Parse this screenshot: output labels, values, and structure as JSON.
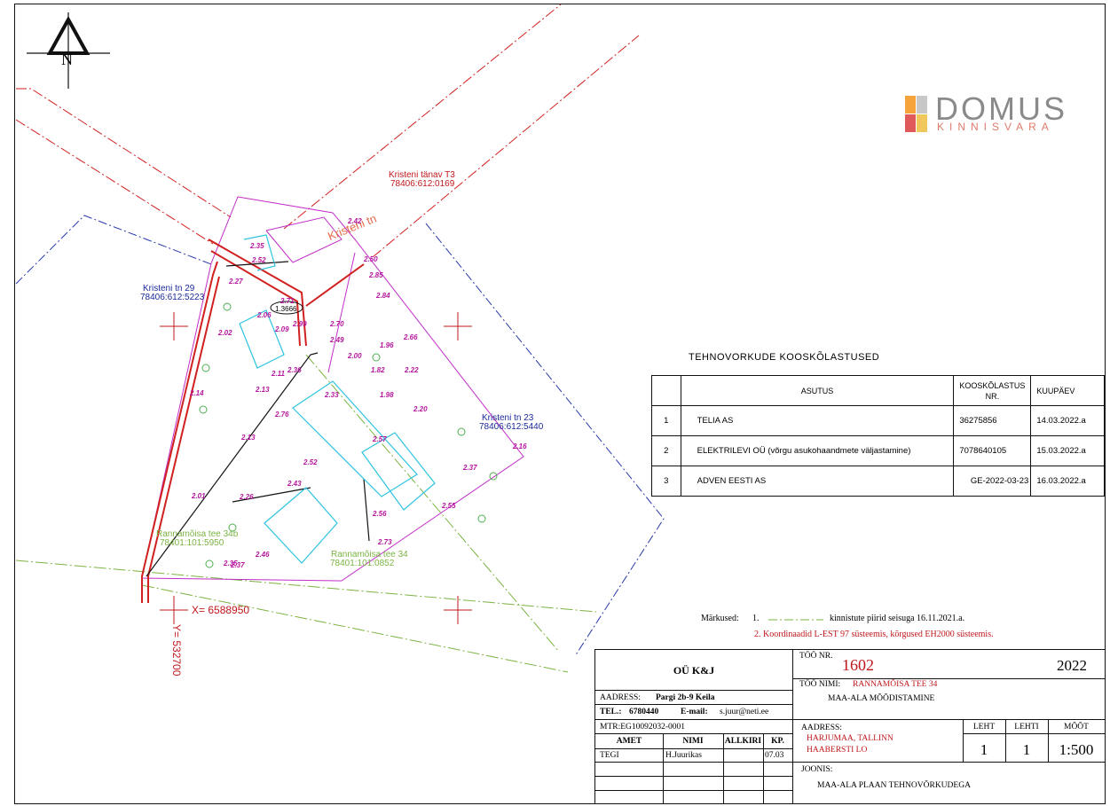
{
  "north_label": "N",
  "logo": {
    "word": "DOMUS",
    "sub": "KINNISVARA",
    "colors": [
      "#f4a43a",
      "#e05a5a",
      "#c8c8c8",
      "#f0c75a"
    ]
  },
  "plan_labels": {
    "street": "Kristeni tänav T3",
    "street_id": "78406:612:0169",
    "street_name_map": "Kristeni tn",
    "parcel29": "Kristeni tn 29",
    "parcel29_id": "78406:612:5223",
    "parcel23": "Kristeni tn 23",
    "parcel23_id": "78406:612:5440",
    "parcel34b": "Rannamõisa tee 34b",
    "parcel34b_id": "78401:101:5950",
    "parcel34": "Rannamõisa tee 34",
    "parcel34_id": "78401:101:0852",
    "area_mark": "1.3666",
    "coord_x": "X= 6588950",
    "coord_y": "Y= 532700",
    "elevations": [
      "2.35",
      "2.52",
      "2.27",
      "2.06",
      "2.02",
      "2.14",
      "2.13",
      "2.01",
      "2.26",
      "2.46",
      "2.35",
      "2.37",
      "2.43",
      "2.52",
      "2.76",
      "2.13",
      "2.11",
      "2.36",
      "2.33",
      "2.49",
      "2.70",
      "2.71",
      "2.00",
      "1.82",
      "1.96",
      "2.22",
      "2.20",
      "1.98",
      "2.57",
      "2.66",
      "2.84",
      "2.85",
      "2.50",
      "2.42",
      "2.09",
      "2.56",
      "2.73",
      "2.55",
      "2.37",
      "2.16",
      "2.99"
    ]
  },
  "approvals": {
    "title": "TEHNOVORKUDE KOOSKÕLASTUSED",
    "headers": [
      "",
      "ASUTUS",
      "KOOSKÕLASTUS NR.",
      "KUUPÄEV"
    ],
    "rows": [
      {
        "nr": "1",
        "asutus": "TELIA AS",
        "kood": "36275856",
        "kuupaev": "14.03.2022.a"
      },
      {
        "nr": "2",
        "asutus": "ELEKTRILEVI OÜ (võrgu asukohaandmete väljastamine)",
        "kood": "7078640105",
        "kuupaev": "15.03.2022.a"
      },
      {
        "nr": "3",
        "asutus": "ADVEN EESTI AS",
        "kood": "GE-2022-03-23",
        "kuupaev": "16.03.2022.a"
      }
    ]
  },
  "notes": {
    "label": "Märkused:",
    "n1_num": "1.",
    "n1_text": "kinnistute piirid seisuga 16.11.2021.a.",
    "n2": "2. Koordinaadid L-EST 97 süsteemis, kõrgused EH2000 süsteemis."
  },
  "title_block": {
    "company": "OÜ K&J",
    "address_label": "AADRESS:",
    "address": "Pargi 2b-9 Keila",
    "tel_label": "TEL.:",
    "tel": "6780440",
    "email_label": "E-mail:",
    "email": "s.juur@neti.ee",
    "mtr": "MTR:EG10092032-0001",
    "col_amet": "AMET",
    "col_nimi": "NIMI",
    "col_allkiri": "ALLKIRI",
    "col_kp": "KP.",
    "row_amet": "TEGI",
    "row_nimi": "H.Juurikas",
    "row_kp": "07.03",
    "work_nr_label": "TÖÖ NR.",
    "work_nr": "1602",
    "year": "2022",
    "work_name_label": "TÖÖ NIMI:",
    "work_name": "RANNAMÕISA TEE 34",
    "work_name2": "MAA-ALA MÕÕDISTAMINE",
    "site_address_label": "AADRESS:",
    "site_address1": "HARJUMAA, TALLINN",
    "site_address2": "HAABERSTI LO",
    "leht_label": "LEHT",
    "lehti_label": "LEHTI",
    "moot_label": "MÕÕT",
    "leht": "1",
    "lehti": "1",
    "moot": "1:500",
    "drawing_label": "JOONIS:",
    "drawing": "MAA-ALA PLAAN TEHNOVÕRKUDEGA"
  }
}
